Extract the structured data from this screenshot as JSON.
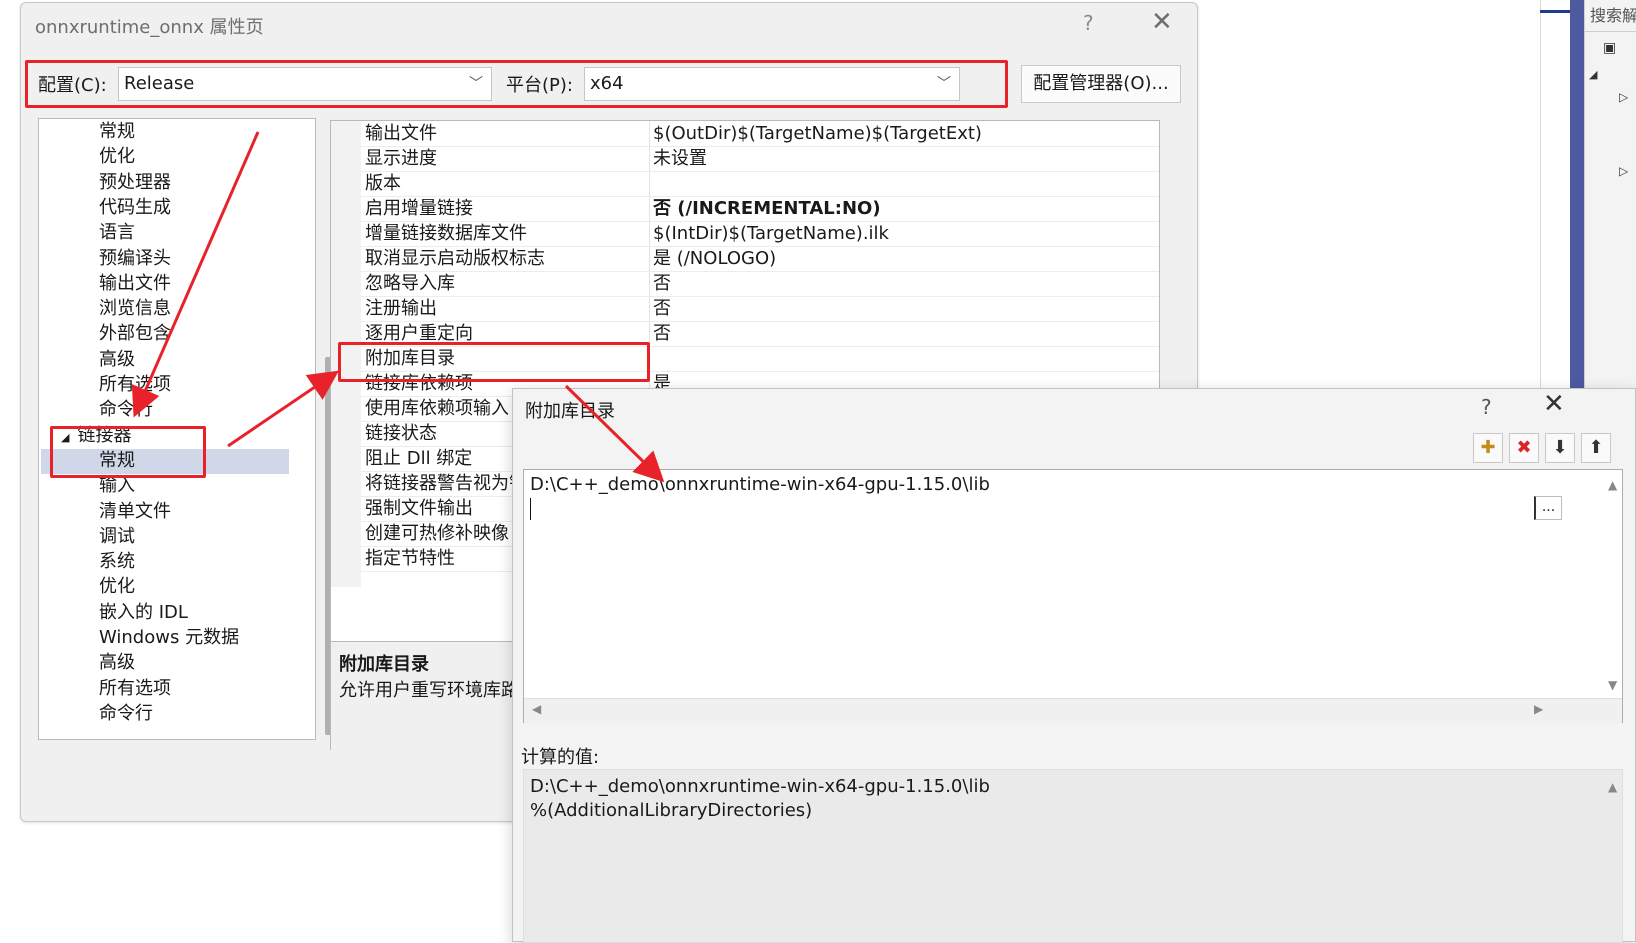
{
  "ide": {
    "search_text": "搜索解",
    "accent_color": "#4d5aa0"
  },
  "dialog": {
    "title": "onnxruntime_onnx 属性页",
    "help": "?",
    "close": "✕",
    "config_label": "配置(C):",
    "config_value": "Release",
    "platform_label": "平台(P):",
    "platform_value": "x64",
    "config_manager_label": "配置管理器(O)..."
  },
  "tree": {
    "items": [
      {
        "label": "常规"
      },
      {
        "label": "优化"
      },
      {
        "label": "预处理器"
      },
      {
        "label": "代码生成"
      },
      {
        "label": "语言"
      },
      {
        "label": "预编译头"
      },
      {
        "label": "输出文件"
      },
      {
        "label": "浏览信息"
      },
      {
        "label": "外部包含"
      },
      {
        "label": "高级"
      },
      {
        "label": "所有选项"
      },
      {
        "label": "命令行"
      },
      {
        "label": "链接器",
        "expanded_marker": "◢"
      },
      {
        "label": "常规",
        "selected": true
      },
      {
        "label": "输入"
      },
      {
        "label": "清单文件"
      },
      {
        "label": "调试"
      },
      {
        "label": "系统"
      },
      {
        "label": "优化"
      },
      {
        "label": "嵌入的 IDL"
      },
      {
        "label": "Windows 元数据"
      },
      {
        "label": "高级"
      },
      {
        "label": "所有选项"
      },
      {
        "label": "命令行"
      }
    ]
  },
  "grid": {
    "rows": [
      {
        "name": "输出文件",
        "value": "$(OutDir)$(TargetName)$(TargetExt)"
      },
      {
        "name": "显示进度",
        "value": "未设置"
      },
      {
        "name": "版本",
        "value": ""
      },
      {
        "name": "启用增量链接",
        "value": "否 (/INCREMENTAL:NO)",
        "bold": true
      },
      {
        "name": "增量链接数据库文件",
        "value": "$(IntDir)$(TargetName).ilk"
      },
      {
        "name": "取消显示启动版权标志",
        "value": "是 (/NOLOGO)"
      },
      {
        "name": "忽略导入库",
        "value": "否"
      },
      {
        "name": "注册输出",
        "value": "否"
      },
      {
        "name": "逐用户重定向",
        "value": "否"
      },
      {
        "name": "附加库目录",
        "value": ""
      },
      {
        "name": "链接库依赖项",
        "value": "是"
      },
      {
        "name": "使用库依赖项输入",
        "value": ""
      },
      {
        "name": "链接状态",
        "value": ""
      },
      {
        "name": "阻止 Dll 绑定",
        "value": ""
      },
      {
        "name": "将链接器警告视为错",
        "value": ""
      },
      {
        "name": "强制文件输出",
        "value": ""
      },
      {
        "name": "创建可热修补映像",
        "value": ""
      },
      {
        "name": "指定节特性",
        "value": ""
      }
    ],
    "desc_title": "附加库目录",
    "desc_text": "允许用户重写环境库路径"
  },
  "subdialog": {
    "title": "附加库目录",
    "help": "?",
    "close": "✕",
    "toolbar": [
      {
        "name": "new-line-button",
        "glyph": "✚"
      },
      {
        "name": "delete-button",
        "glyph": "✖"
      },
      {
        "name": "move-down-button",
        "glyph": "⬇"
      },
      {
        "name": "move-up-button",
        "glyph": "⬆"
      }
    ],
    "list_items": [
      "D:\\C++_demo\\onnxruntime-win-x64-gpu-1.15.0\\lib"
    ],
    "browse_label": "...",
    "calc_label": "计算的值:",
    "calc_lines": [
      "D:\\C++_demo\\onnxruntime-win-x64-gpu-1.15.0\\lib",
      "%(AdditionalLibraryDirectories)"
    ]
  },
  "annotation_color": "#e8212a"
}
